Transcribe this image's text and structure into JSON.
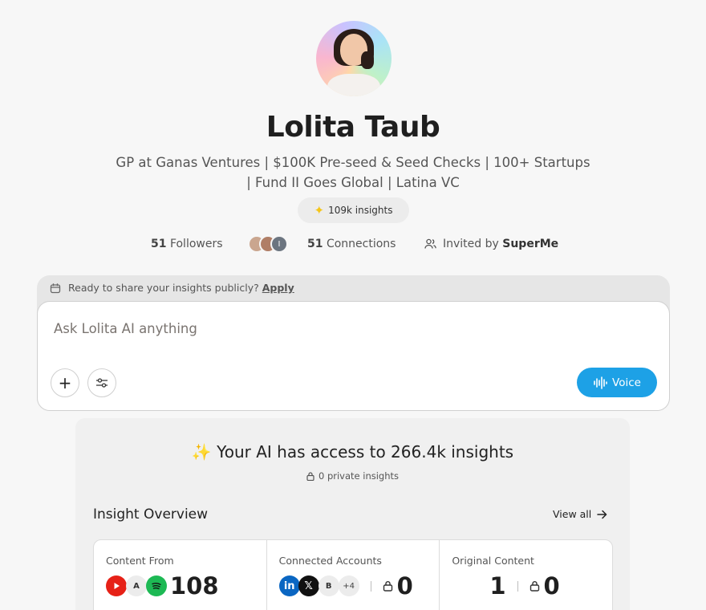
{
  "profile": {
    "name": "Lolita Taub",
    "bio_line1": "GP at Ganas Ventures | $100K Pre-seed & Seed Checks | 100+ Startups",
    "bio_line2": "| Fund II Goes Global | Latina VC",
    "insights_badge": "109k insights"
  },
  "stats": {
    "followers_count": "51",
    "followers_label": "Followers",
    "connections_count": "51",
    "connections_label": "Connections",
    "connections_avatar_initial": "I",
    "invited_prefix": "Invited by",
    "invited_by": "SuperMe"
  },
  "chat": {
    "banner_text": "Ready to share your insights publicly?",
    "banner_link": "Apply",
    "placeholder": "Ask Lolita AI anything",
    "add_label": "+",
    "voice_label": "Voice",
    "accent_color": "#1da1e6"
  },
  "insights": {
    "headline": "Your AI has access to 266.4k insights",
    "private_count": "0 private insights",
    "overview_title": "Insight Overview",
    "view_all": "View all",
    "cards": [
      {
        "label": "Content From",
        "icons": [
          "youtube-icon",
          "A",
          "spotify-icon"
        ],
        "value": "108"
      },
      {
        "label": "Connected Accounts",
        "icons": [
          "linkedin-icon",
          "x-icon",
          "B",
          "+4"
        ],
        "private_value": "0"
      },
      {
        "label": "Original Content",
        "value": "1",
        "private_value": "0"
      }
    ]
  }
}
